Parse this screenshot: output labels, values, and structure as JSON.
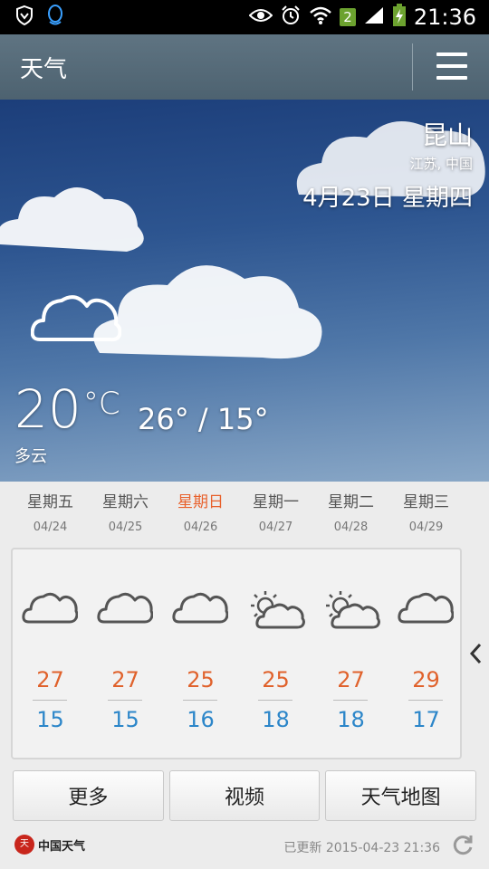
{
  "status_bar": {
    "time": "21:36",
    "sim_badge": "2",
    "icons": [
      "shield-icon",
      "qq-penguin-icon",
      "eye-icon",
      "alarm-icon",
      "wifi-icon",
      "signal-icon",
      "battery-charging-icon"
    ]
  },
  "app_bar": {
    "title": "天气",
    "menu_icon": "hamburger-menu-icon"
  },
  "current": {
    "city": "昆山",
    "region": "江苏, 中国",
    "date": "4月23日 星期四",
    "temp": "20",
    "unit": "°C",
    "range": "26° / 15°",
    "condition": "多云",
    "icon": "cloud-icon"
  },
  "forecast": [
    {
      "weekday": "星期五",
      "date": "04/24",
      "icon": "cloud-icon",
      "high": "27",
      "low": "15"
    },
    {
      "weekday": "星期六",
      "date": "04/25",
      "icon": "cloud-icon",
      "high": "27",
      "low": "15"
    },
    {
      "weekday": "星期日",
      "date": "04/26",
      "icon": "cloud-icon",
      "high": "25",
      "low": "16"
    },
    {
      "weekday": "星期一",
      "date": "04/27",
      "icon": "partly-sunny-icon",
      "high": "25",
      "low": "18"
    },
    {
      "weekday": "星期二",
      "date": "04/28",
      "icon": "partly-sunny-icon",
      "high": "27",
      "low": "18"
    },
    {
      "weekday": "星期三",
      "date": "04/29",
      "icon": "cloud-icon",
      "high": "29",
      "low": "17"
    }
  ],
  "buttons": {
    "more": "更多",
    "video": "视频",
    "map": "天气地图"
  },
  "footer": {
    "logo_text": "中国天气",
    "updated": "已更新 2015-04-23 21:36"
  },
  "colors": {
    "high": "#e0622c",
    "low": "#2c86c9",
    "today": "#e8612c",
    "appbar": "#566b79"
  }
}
